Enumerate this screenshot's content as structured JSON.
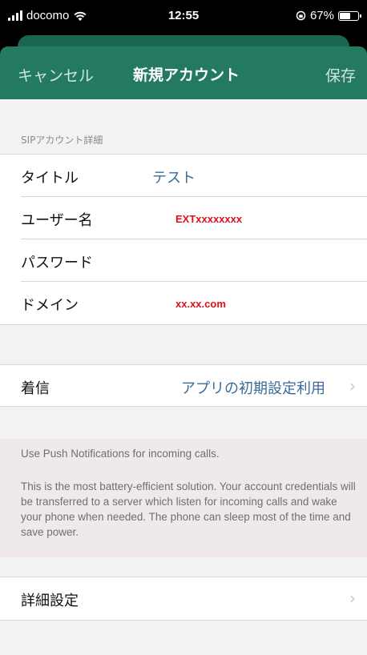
{
  "status_bar": {
    "carrier": "docomo",
    "time": "12:55",
    "battery": "67%",
    "battery_level": 0.67
  },
  "nav": {
    "cancel": "キャンセル",
    "title": "新規アカウント",
    "save": "保存"
  },
  "sip_section": {
    "header": "SIPアカウント詳細",
    "rows": [
      {
        "label": "タイトル",
        "value": "テスト"
      },
      {
        "label": "ユーザー名",
        "value": "EXTxxxxxxxx"
      },
      {
        "label": "パスワード",
        "value": ""
      },
      {
        "label": "ドメイン",
        "value": "xx.xx.com"
      }
    ]
  },
  "incoming": {
    "label": "着信",
    "value": "アプリの初期設定利用"
  },
  "push_info": {
    "line1": "Use Push Notifications for incoming calls.",
    "paragraph": "This is the most battery-efficient solution. Your account credentials will be transferred to a server which listen for incoming calls and wake your phone when needed. The phone can sleep most of the time and save power."
  },
  "advanced": {
    "label": "詳細設定"
  },
  "colors": {
    "nav_bg": "#237a60",
    "link": "#3a6b9a",
    "highlight_red": "#e0101b"
  }
}
